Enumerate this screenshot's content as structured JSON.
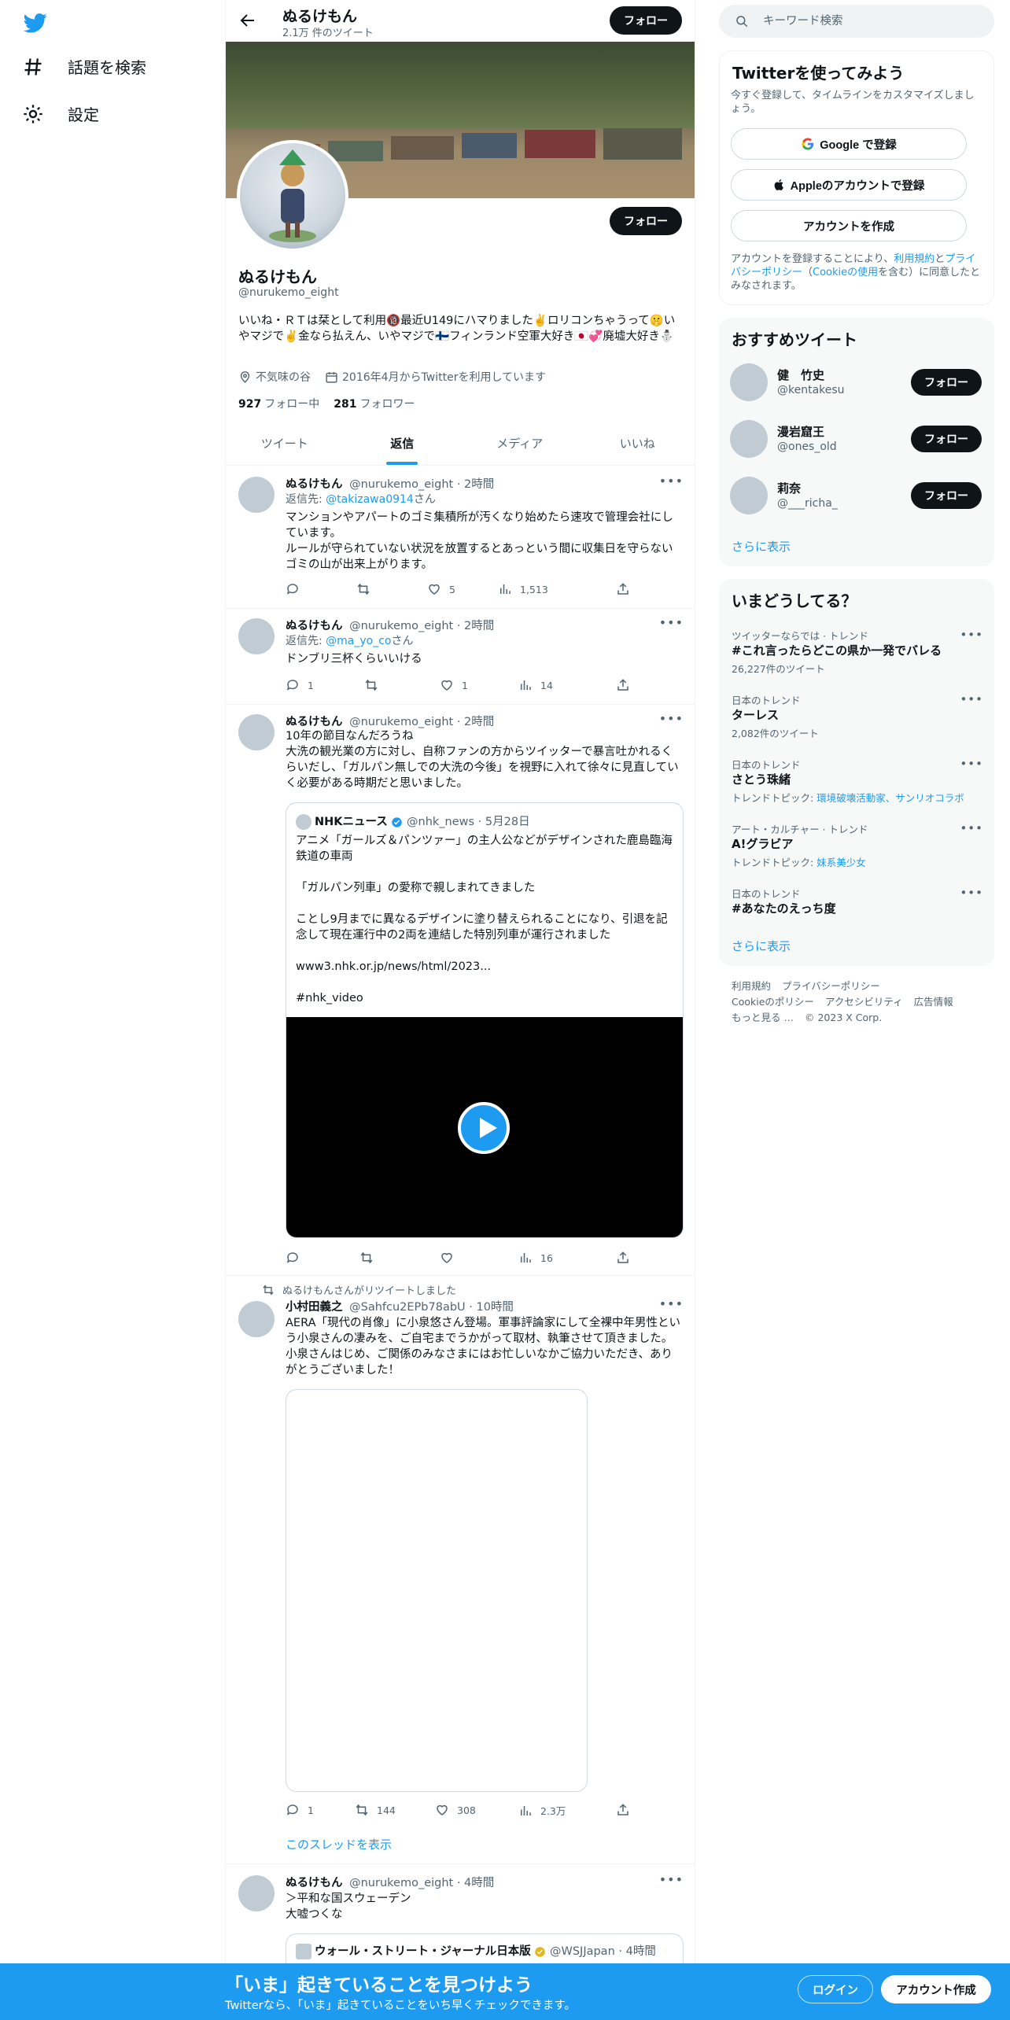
{
  "nav": {
    "explore_label": "話題を検索",
    "settings_label": "設定"
  },
  "header": {
    "name": "ぬるけもん",
    "tweet_count": "2.1万 件のツイート",
    "follow_label": "フォロー"
  },
  "profile": {
    "name": "ぬるけもん",
    "handle": "@nurukemo_eight",
    "bio": "いいね・ＲＴは栞として利用🔞最近U149にハマりました✌️ロリコンちゃうって🤫いやマジで✌️金なら払えん、いやマジで🇫🇮フィンランド空軍大好き🇯🇵💞廃墟大好き⛄",
    "location": "不気味の谷",
    "joined": "2016年4月からTwitterを利用しています",
    "following_count": "927",
    "following_label": "フォロー中",
    "followers_count": "281",
    "followers_label": "フォロワー",
    "follow_label": "フォロー"
  },
  "tabs": [
    "ツイート",
    "返信",
    "メディア",
    "いいね"
  ],
  "tweets": [
    {
      "name": "ぬるけもん",
      "handle": "@nurukemo_eight",
      "time": "· 2時間",
      "reply_prefix": "返信先: ",
      "reply_to": "@takizawa0914",
      "reply_suffix": "さん",
      "text": "マンションやアパートのゴミ集積所が汚くなり始めたら速攻で管理会社にしています。\nルールが守られていない状況を放置するとあっという間に収集日を守らないゴミの山が出来上がります。",
      "replies": "",
      "retweets": "",
      "likes": "5",
      "views": "1,513"
    },
    {
      "name": "ぬるけもん",
      "handle": "@nurukemo_eight",
      "time": "· 2時間",
      "reply_prefix": "返信先: ",
      "reply_to": "@ma_yo_co",
      "reply_suffix": "さん",
      "text": "ドンブリ三杯くらいいける",
      "replies": "1",
      "retweets": "",
      "likes": "1",
      "views": "14"
    },
    {
      "name": "ぬるけもん",
      "handle": "@nurukemo_eight",
      "time": "· 2時間",
      "text": "10年の節目なんだろうね\n大洗の観光業の方に対し、自称ファンの方からツイッターで暴言吐かれるくらいだし、「ガルパン無しでの大洗の今後」を視野に入れて徐々に見直していく必要がある時期だと思いました。",
      "quote": {
        "name": "NHKニュース",
        "handle": "@nhk_news",
        "time": "· 5月28日",
        "text": "アニメ「ガールズ＆パンツァー」の主人公などがデザインされた鹿島臨海鉄道の車両\n\n「ガルパン列車」の愛称で親しまれてきました\n\nことし9月までに異なるデザインに塗り替えられることになり、引退を記念して現在運行中の2両を連結した特別列車が運行されました\n\nwww3.nhk.or.jp/news/html/2023...\n\n#nhk_video"
      },
      "replies": "",
      "retweets": "",
      "likes": "",
      "views": "16"
    },
    {
      "retweet_note": "ぬるけもんさんがリツイートしました",
      "name": "小村田義之",
      "handle": "@Sahfcu2EPb78abU",
      "time": "· 10時間",
      "text": "AERA「現代の肖像」に小泉悠さん登場。軍事評論家にして全裸中年男性という小泉さんの凄みを、ご自宅までうかがって取材、執筆させて頂きました。小泉さんはじめ、ご関係のみなさまにはお忙しいなかご協力いただき、ありがとうございました！",
      "replies": "1",
      "retweets": "144",
      "likes": "308",
      "views": "2.3万",
      "thread_label": "このスレッドを表示"
    },
    {
      "name": "ぬるけもん",
      "handle": "@nurukemo_eight",
      "time": "· 4時間",
      "text": "＞平和な国スウェーデン\n大嘘つくな",
      "quote": {
        "name": "ウォール・ストリート・ジャーナル日本版",
        "handle": "@WSJJapan",
        "time": "· 4時間"
      }
    }
  ],
  "sidebar": {
    "search_placeholder": "キーワード検索",
    "signup": {
      "title": "Twitterを使ってみよう",
      "subtitle": "今すぐ登録して、タイムラインをカスタマイズしましょう。",
      "google_label": "Google で登録",
      "apple_label": "Appleのアカウントで登録",
      "create_label": "アカウントを作成",
      "legal_prefix": "アカウントを登録することにより、",
      "terms": "利用規約",
      "and": "と",
      "privacy": "プライバシーポリシー",
      "paren_open": "（",
      "cookie": "Cookieの使用",
      "legal_suffix": "を含む）に同意したとみなされます。"
    },
    "recommended": {
      "title": "おすすめツイート",
      "users": [
        {
          "name": "健　竹史",
          "handle": "@kentakesu",
          "follow": "フォロー"
        },
        {
          "name": "漫岩窟王",
          "handle": "@ones_old",
          "follow": "フォロー"
        },
        {
          "name": "莉奈",
          "handle": "@___richa_",
          "follow": "フォロー"
        }
      ],
      "show_more": "さらに表示"
    },
    "trends": {
      "title": "いまどうしてる？",
      "items": [
        {
          "meta": "ツイッターならでは · トレンド",
          "title": "#これ言ったらどこの県か一発でバレる",
          "sub": "26,227件のツイート"
        },
        {
          "meta": "日本のトレンド",
          "title": "ターレス",
          "sub": "2,082件のツイート"
        },
        {
          "meta": "日本のトレンド",
          "title": "さとう珠緒",
          "sub_prefix": "トレンドトピック: ",
          "sub_links": "環境破壊活動家、サンリオコラボ"
        },
        {
          "meta": "アート・カルチャー · トレンド",
          "title": "A!グラビア",
          "sub_prefix": "トレンドトピック: ",
          "sub_links": "妹系美少女"
        },
        {
          "meta": "日本のトレンド",
          "title": "#あなたのえっち度"
        }
      ],
      "show_more": "さらに表示"
    },
    "footer": [
      "利用規約",
      "プライバシーポリシー",
      "Cookieのポリシー",
      "アクセシビリティ",
      "広告情報",
      "もっと見る …",
      "© 2023 X Corp."
    ]
  },
  "bottombar": {
    "title": "「いま」起きていることを見つけよう",
    "subtitle": "Twitterなら、「いま」起きていることをいち早くチェックできます。",
    "login": "ログイン",
    "signup": "アカウント作成"
  }
}
